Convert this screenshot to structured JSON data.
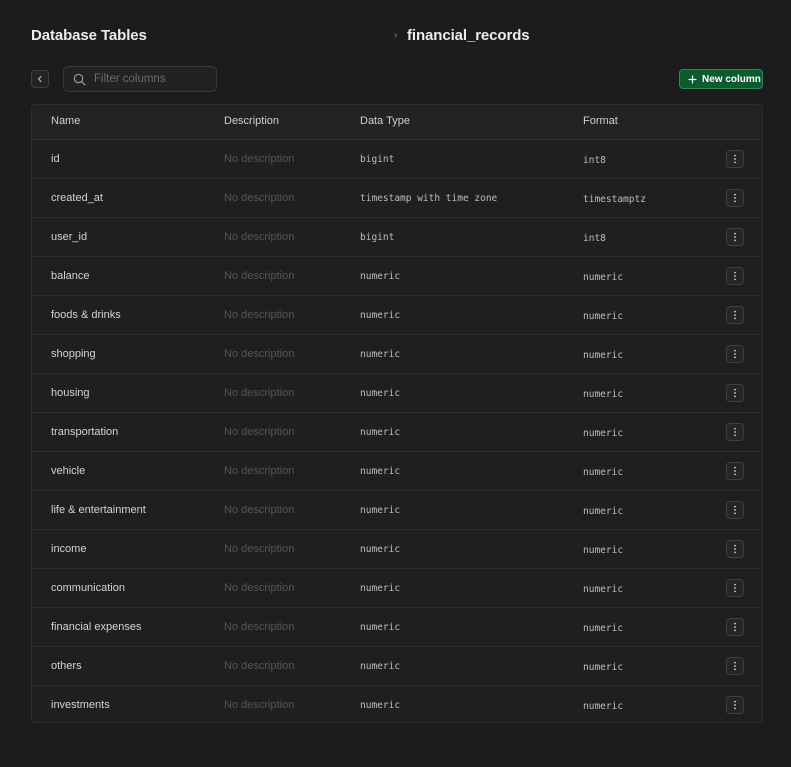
{
  "header": {
    "title": "Database Tables",
    "separator": "›",
    "table_name": "financial_records"
  },
  "toolbar": {
    "back_icon": "chevron-left-icon",
    "search_icon": "search-icon",
    "filter_placeholder": "Filter columns",
    "filter_value": "",
    "new_column_icon": "plus-icon",
    "new_column_label": "New column"
  },
  "colors": {
    "background": "#1c1c1c",
    "accent": "#0b5b2f",
    "accent_border": "#2f8a57"
  },
  "table": {
    "headers": {
      "name": "Name",
      "description": "Description",
      "data_type": "Data Type",
      "format": "Format"
    },
    "row_action_icon": "more-vertical-icon",
    "rows": [
      {
        "name": "id",
        "description": "No description",
        "data_type": "bigint",
        "format": "int8"
      },
      {
        "name": "created_at",
        "description": "No description",
        "data_type": "timestamp with time zone",
        "format": "timestamptz"
      },
      {
        "name": "user_id",
        "description": "No description",
        "data_type": "bigint",
        "format": "int8"
      },
      {
        "name": "balance",
        "description": "No description",
        "data_type": "numeric",
        "format": "numeric"
      },
      {
        "name": "foods & drinks",
        "description": "No description",
        "data_type": "numeric",
        "format": "numeric"
      },
      {
        "name": "shopping",
        "description": "No description",
        "data_type": "numeric",
        "format": "numeric"
      },
      {
        "name": "housing",
        "description": "No description",
        "data_type": "numeric",
        "format": "numeric"
      },
      {
        "name": "transportation",
        "description": "No description",
        "data_type": "numeric",
        "format": "numeric"
      },
      {
        "name": "vehicle",
        "description": "No description",
        "data_type": "numeric",
        "format": "numeric"
      },
      {
        "name": "life & entertainment",
        "description": "No description",
        "data_type": "numeric",
        "format": "numeric"
      },
      {
        "name": "income",
        "description": "No description",
        "data_type": "numeric",
        "format": "numeric"
      },
      {
        "name": "communication",
        "description": "No description",
        "data_type": "numeric",
        "format": "numeric"
      },
      {
        "name": "financial expenses",
        "description": "No description",
        "data_type": "numeric",
        "format": "numeric"
      },
      {
        "name": "others",
        "description": "No description",
        "data_type": "numeric",
        "format": "numeric"
      },
      {
        "name": "investments",
        "description": "No description",
        "data_type": "numeric",
        "format": "numeric"
      }
    ]
  }
}
